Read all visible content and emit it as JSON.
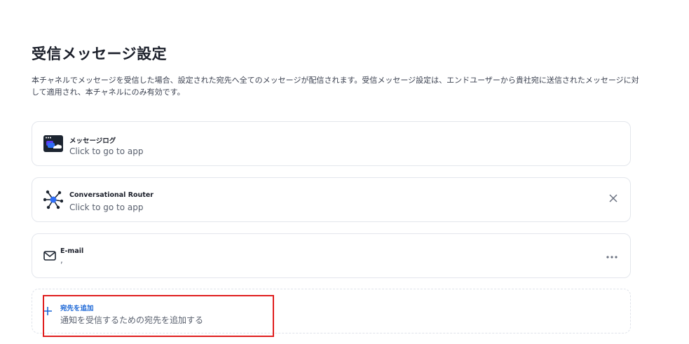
{
  "page": {
    "title": "受信メッセージ設定",
    "description": "本チャネルでメッセージを受信した場合、設定された宛先へ全てのメッセージが配信されます。受信メッセージ設定は、エンドユーザーから貴社宛に送信されたメッセージに対して適用され、本チャネルにのみ有効です。"
  },
  "destinations": [
    {
      "name": "メッセージログ",
      "subtitle": "Click to go to app",
      "icon": "message-log-app-icon"
    },
    {
      "name": "Conversational Router",
      "subtitle": "Click to go to app",
      "icon": "router-network-icon",
      "action": "×"
    },
    {
      "name": "E-mail",
      "subtitle": ",",
      "icon": "mail-icon",
      "action": "•••"
    }
  ],
  "add_destination": {
    "label": "宛先を追加",
    "description": "通知を受信するための宛先を追加する",
    "icon": "plus-icon"
  },
  "colors": {
    "accent": "#1a66d6",
    "highlight": "#e01e1e"
  }
}
